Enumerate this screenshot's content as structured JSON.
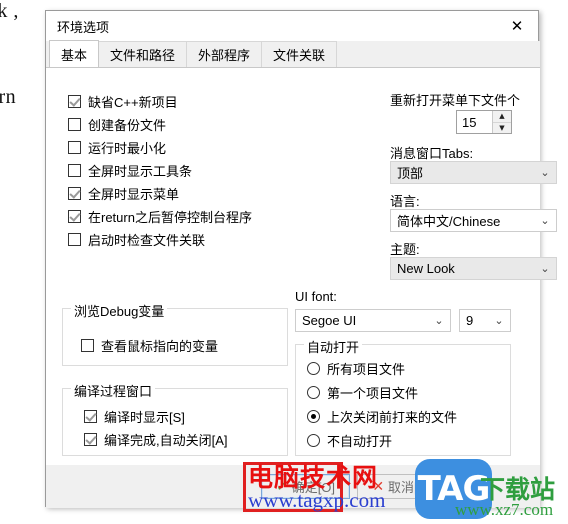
{
  "background_code": {
    "lines": [
      "ak ,",
      ":",
      ":",
      "urn",
      ";",
      ";"
    ]
  },
  "dialog": {
    "title": "环境选项",
    "close_icon": "✕",
    "tabs": [
      {
        "label": "基本",
        "active": true
      },
      {
        "label": "文件和路径",
        "active": false
      },
      {
        "label": "外部程序",
        "active": false
      },
      {
        "label": "文件关联",
        "active": false
      }
    ],
    "checkboxes": [
      {
        "label": "缺省C++新项目",
        "checked": true
      },
      {
        "label": "创建备份文件",
        "checked": false
      },
      {
        "label": "运行时最小化",
        "checked": false
      },
      {
        "label": "全屏时显示工具条",
        "checked": false
      },
      {
        "label": "全屏时显示菜单",
        "checked": true
      },
      {
        "label": "在return之后暂停控制台程序",
        "checked": true
      },
      {
        "label": "启动时检查文件关联",
        "checked": false
      }
    ],
    "debug_group": {
      "title": "浏览Debug变量",
      "checkbox": {
        "label": "查看鼠标指向的变量",
        "checked": false
      }
    },
    "compile_group": {
      "title": "编译过程窗口",
      "checkboxes": [
        {
          "label": "编译时显示[S]",
          "checked": true
        },
        {
          "label": "编译完成,自动关闭[A]",
          "checked": true
        }
      ]
    },
    "reopen": {
      "label": "重新打开菜单下文件个",
      "value": "15",
      "up_icon": "▲",
      "down_icon": "▼"
    },
    "msg_tabs": {
      "label": "消息窗口Tabs:",
      "value": "顶部",
      "arrow_icon": "⌄",
      "disabled": true
    },
    "language": {
      "label": "语言:",
      "value": "简体中文/Chinese",
      "arrow_icon": "⌄",
      "disabled": false
    },
    "theme": {
      "label": "主题:",
      "value": "New Look",
      "arrow_icon": "⌄",
      "disabled": true
    },
    "ui_font": {
      "label": "UI font:",
      "family_value": "Segoe UI",
      "size_value": "9",
      "arrow_icon": "⌄"
    },
    "autoopen_group": {
      "title": "自动打开",
      "radios": [
        {
          "label": "所有项目文件",
          "selected": false
        },
        {
          "label": "第一个项目文件",
          "selected": false
        },
        {
          "label": "上次关闭前打来的文件",
          "selected": true
        },
        {
          "label": "不自动打开",
          "selected": false
        }
      ]
    },
    "footer": {
      "ok_label": "确定[O]",
      "ok_icon": "✓",
      "cancel_label": "取消[C]",
      "cancel_icon": "✕"
    }
  },
  "watermarks": {
    "red_text": "电脑技术网",
    "blue_url": "www.tagxp.com",
    "tag_text": "TAG",
    "green_text": "下载站",
    "green_url": "www.xz7.com"
  },
  "colors": {
    "accent": "#3d8fe0",
    "ok_green": "#4caf50",
    "cancel_red": "#e23b2e",
    "watermark_red": "#e81010",
    "watermark_green": "#2f9e3f"
  }
}
